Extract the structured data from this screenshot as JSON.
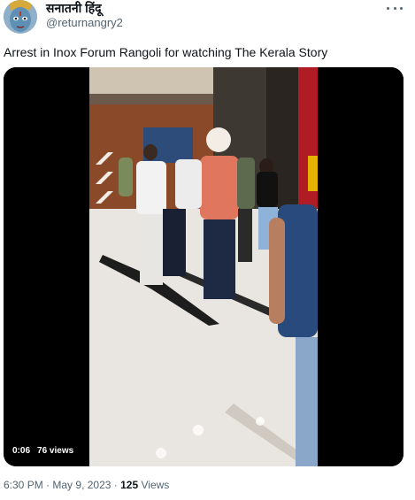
{
  "author": {
    "display_name": "सनातनी हिंदू",
    "handle": "@returnangry2",
    "avatar_icon": "deity-avatar-icon"
  },
  "more_icon": "more-options-icon",
  "tweet": {
    "text": "Arrest in Inox Forum Rangoli for watching The Kerala Story"
  },
  "video": {
    "duration": "0:06",
    "views": "76 views"
  },
  "meta": {
    "time": "6:30 PM",
    "separator": "·",
    "date": "May 9, 2023",
    "views_count": "125",
    "views_label": "Views"
  },
  "colors": {
    "text_primary": "#0f1419",
    "text_secondary": "#536471",
    "media_background": "#000000"
  }
}
